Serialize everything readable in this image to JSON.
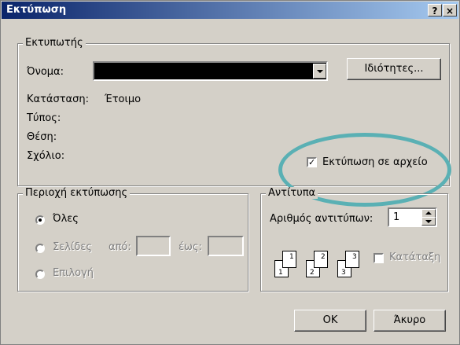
{
  "window": {
    "title": "Εκτύπωση",
    "help_glyph": "?",
    "close_glyph": "×"
  },
  "printer": {
    "legend": "Εκτυπωτής",
    "name_label": "Όνομα:",
    "properties_button": "Ιδιότητες...",
    "status_label": "Κατάσταση:",
    "status_value": "Έτοιμο",
    "type_label": "Τύπος:",
    "where_label": "Θέση:",
    "comment_label": "Σχόλιο:",
    "print_to_file": {
      "label": "Εκτύπωση σε αρχείο",
      "checked": true
    }
  },
  "range": {
    "legend": "Περιοχή εκτύπωσης",
    "all": "Όλες",
    "pages": "Σελίδες",
    "from": "από:",
    "to": "έως:",
    "selection": "Επιλογή",
    "selected": "all"
  },
  "copies": {
    "legend": "Αντίτυπα",
    "count_label": "Αριθμός αντιτύπων:",
    "count_value": "1",
    "collate_label": "Κατάταξη",
    "collate_checked": false,
    "page_numbers": [
      "1",
      "1",
      "2",
      "2",
      "3",
      "3"
    ]
  },
  "buttons": {
    "ok": "OK",
    "cancel": "Άκυρο"
  },
  "colors": {
    "title_start": "#0a246a",
    "title_end": "#a6caf0",
    "highlight": "#5ab0b4",
    "face": "#d4d0c8"
  }
}
